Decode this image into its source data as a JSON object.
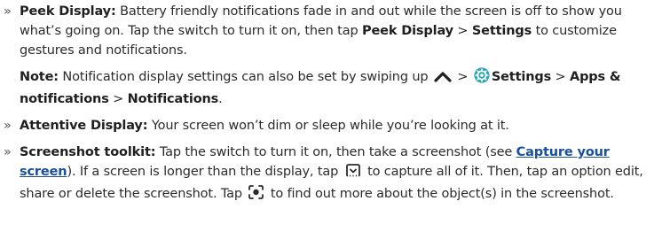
{
  "bullet_glyph": "»",
  "peek": {
    "title": "Peek Display:",
    "text1": " Battery friendly notifications fade in and out while the screen is off to show you what’s going on. Tap the switch to turn it on, then tap ",
    "bold1": "Peek Display",
    "sep": " > ",
    "bold2": "Settings",
    "text2": " to customize gestures and notifications."
  },
  "note": {
    "label": "Note:",
    "text1": " Notification display settings can also be set by swiping up ",
    "sep1": " > ",
    "settings": "Settings",
    "sep2": " > ",
    "apps": "Apps & notifications",
    "sep3": " > ",
    "notifications": "Notifications",
    "end": "."
  },
  "attentive": {
    "title": "Attentive Display:",
    "text": " Your screen won’t dim or sleep while you’re looking at it."
  },
  "screenshot": {
    "title": "Screenshot toolkit:",
    "text1": " Tap the switch to turn it on, then take a screenshot (see ",
    "link": "Capture your screen",
    "text2": "). If a screen is longer than the display, tap ",
    "text3": " to capture all of it. Then, tap an option edit, share or delete the screenshot. Tap ",
    "text4": " to find out more about the object(s) in the screenshot."
  },
  "icons": {
    "swipe_up": "chevron-up-icon",
    "settings": "settings-gear-icon",
    "capture_more": "capture-more-icon",
    "lens": "lens-icon"
  },
  "colors": {
    "text": "#2b2b2b",
    "link": "#1a4f9c",
    "settings_icon": "#2aa6b8"
  }
}
